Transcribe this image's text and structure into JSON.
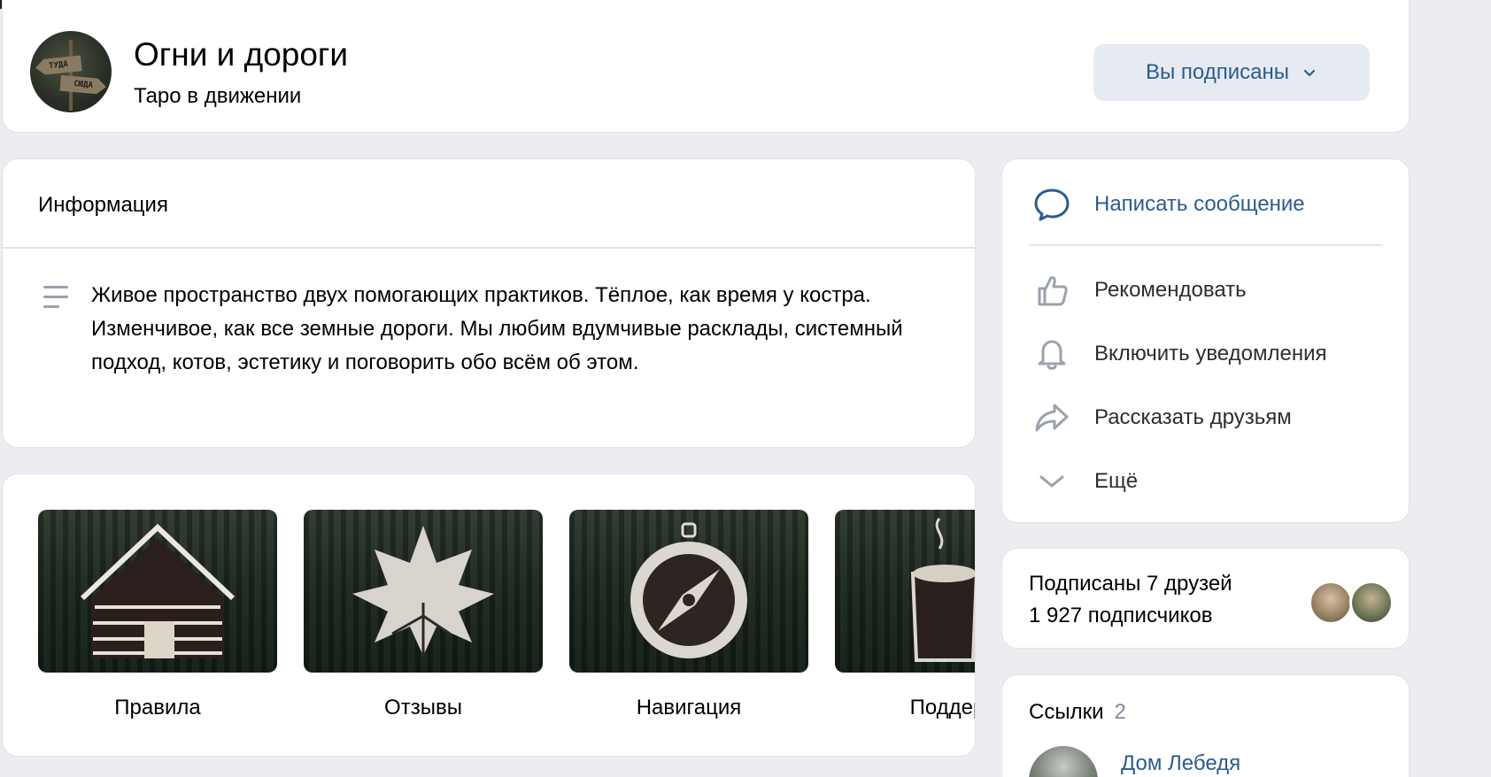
{
  "header": {
    "title": "Огни и дороги",
    "subtitle": "Таро в движении",
    "avatar_signs": [
      "ТУДА",
      "СЮДА"
    ],
    "subscribe_button": "Вы подписаны"
  },
  "info": {
    "heading": "Информация",
    "description": "Живое пространство двух помогающих практиков. Тёплое, как время у костра. Изменчивое, как все земные дороги. Мы любим вдумчивые расклады, системный подход, котов, эстетику и поговорить обо всём об этом."
  },
  "tiles": [
    {
      "label": "Правила",
      "icon": "house-icon"
    },
    {
      "label": "Отзывы",
      "icon": "leaf-icon"
    },
    {
      "label": "Навигация",
      "icon": "compass-icon"
    },
    {
      "label": "Поддерж",
      "icon": "mug-icon"
    }
  ],
  "actions": {
    "message": "Написать сообщение",
    "recommend": "Рекомендовать",
    "notifications": "Включить уведомления",
    "share": "Рассказать друзьям",
    "more": "Ещё"
  },
  "friends": {
    "line1": "Подписаны 7 друзей",
    "line2": "1 927 подписчиков"
  },
  "links": {
    "heading": "Ссылки",
    "count": "2",
    "first_link": "Дом Лебедя"
  },
  "colors": {
    "accent": "#2c5b8f",
    "background": "#ebedf0",
    "button_bg": "#e5ebf1",
    "icon_gray": "#99a2ad"
  }
}
